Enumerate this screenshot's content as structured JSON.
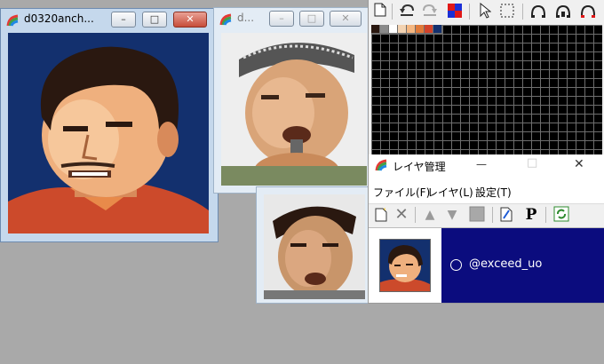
{
  "window_main": {
    "title": "d0320anch...",
    "minimize": "–",
    "maximize": "□",
    "close": "✕"
  },
  "window_second": {
    "title": "d...",
    "minimize": "–",
    "maximize": "□",
    "close": "✕"
  },
  "palette_toolbar": {
    "icons": [
      "new-icon",
      "undo-icon",
      "redo-icon",
      "palette-color-icon",
      "pointer-icon",
      "select-rect-icon",
      "layer-up-icon",
      "layer-down-icon",
      "layer-delete-icon"
    ]
  },
  "palette_colors": [
    "#2a1810",
    "#8a8a8a",
    "#ffffff",
    "#f3d3b2",
    "#f5b781",
    "#e07a3a",
    "#d2422a",
    "#13306e"
  ],
  "layer_window": {
    "title": "レイヤ管理",
    "minimize": "—",
    "maximize": "□",
    "close": "✕",
    "menu": [
      "ファイル(F)",
      "レイヤ(L)",
      "設定(T)"
    ],
    "layer_name": "@exceed_uo",
    "layer_bg": "#0b0c7e"
  }
}
